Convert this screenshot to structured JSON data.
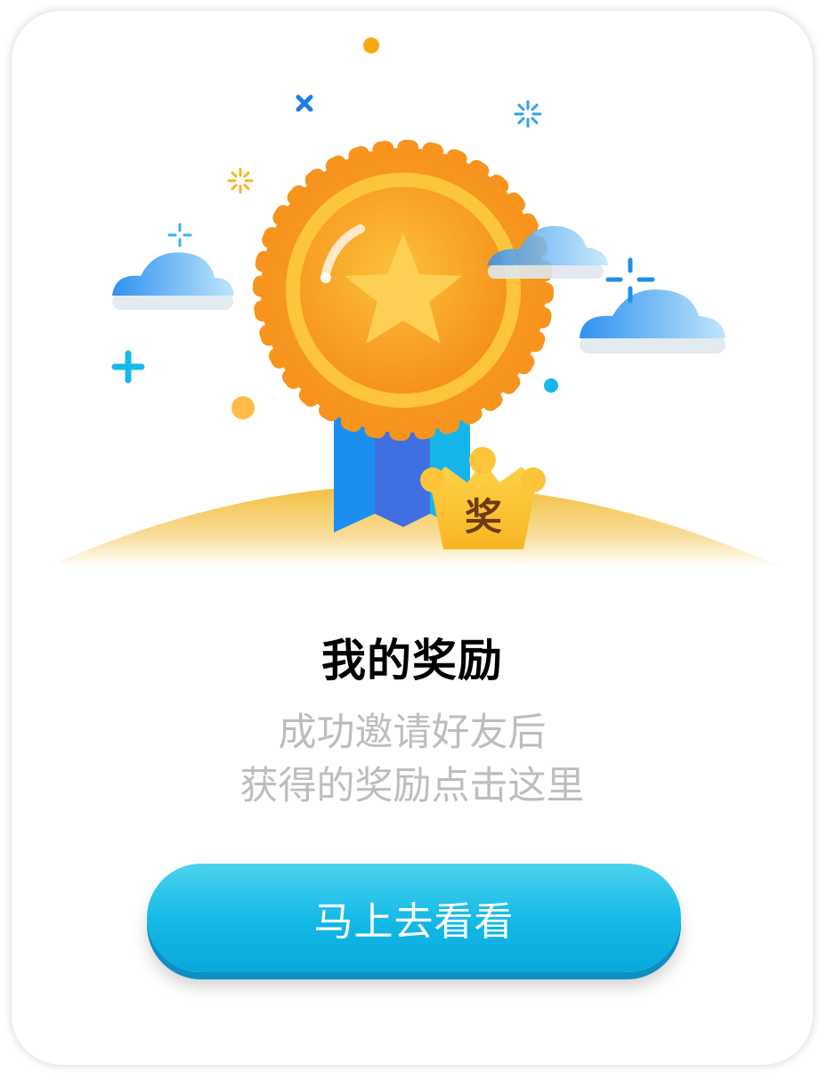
{
  "dialog": {
    "title": "我的奖励",
    "subtitle_line1": "成功邀请好友后",
    "subtitle_line2": "获得的奖励点击这里",
    "cta_label": "马上去看看"
  },
  "badge": {
    "crown_text": "奖"
  },
  "colors": {
    "medal_orange": "#f79a1f",
    "medal_inner": "#fbb52b",
    "star": "#ffd35a",
    "ribbon_blue": "#1a7ff0",
    "crown_yellow": "#fdc43a",
    "hill_yellow": "#f4c550",
    "cloud_blue": "#5fb5f4",
    "button_blue": "#12b8e6",
    "subtitle_gray": "#bdbdbd"
  },
  "icons": [
    "medal-icon",
    "star-icon",
    "crown-badge-icon",
    "cloud-icon",
    "sparkle-icon",
    "plus-icon",
    "cross-icon",
    "dot-icon"
  ]
}
